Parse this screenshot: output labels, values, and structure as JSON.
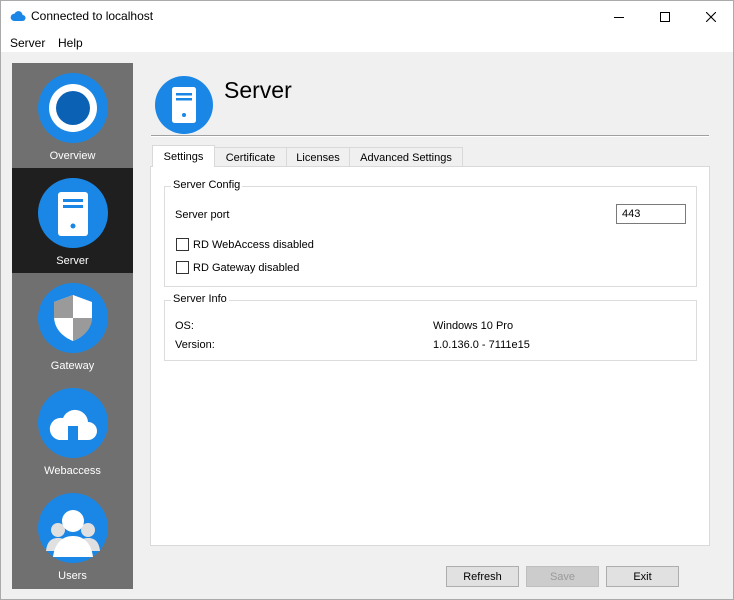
{
  "window": {
    "title": "Connected to localhost",
    "controls": {
      "minimize": "minimize",
      "maximize": "maximize",
      "close": "close"
    }
  },
  "menu": [
    "Server",
    "Help"
  ],
  "sidebar": {
    "accent": "#1a87e6",
    "items": [
      {
        "label": "Overview",
        "icon": "overview-icon",
        "active": false
      },
      {
        "label": "Server",
        "icon": "server-icon",
        "active": true
      },
      {
        "label": "Gateway",
        "icon": "shield-icon",
        "active": false
      },
      {
        "label": "Webaccess",
        "icon": "cloud-icon",
        "active": false
      },
      {
        "label": "Users",
        "icon": "users-icon",
        "active": false
      }
    ]
  },
  "header": {
    "title": "Server",
    "icon": "server-icon"
  },
  "tabs": [
    {
      "label": "Settings",
      "active": true
    },
    {
      "label": "Certificate",
      "active": false
    },
    {
      "label": "Licenses",
      "active": false
    },
    {
      "label": "Advanced Settings",
      "active": false
    }
  ],
  "server_config": {
    "title": "Server Config",
    "port_label": "Server port",
    "port_value": "443",
    "webaccess_disabled_label": "RD WebAccess disabled",
    "webaccess_disabled_checked": false,
    "gateway_disabled_label": "RD Gateway disabled",
    "gateway_disabled_checked": false
  },
  "server_info": {
    "title": "Server Info",
    "os_label": "OS:",
    "os_value": "Windows 10 Pro",
    "version_label": "Version:",
    "version_value": "1.0.136.0 - 7111e15"
  },
  "buttons": {
    "refresh": "Refresh",
    "save": "Save",
    "save_enabled": false,
    "exit": "Exit"
  }
}
